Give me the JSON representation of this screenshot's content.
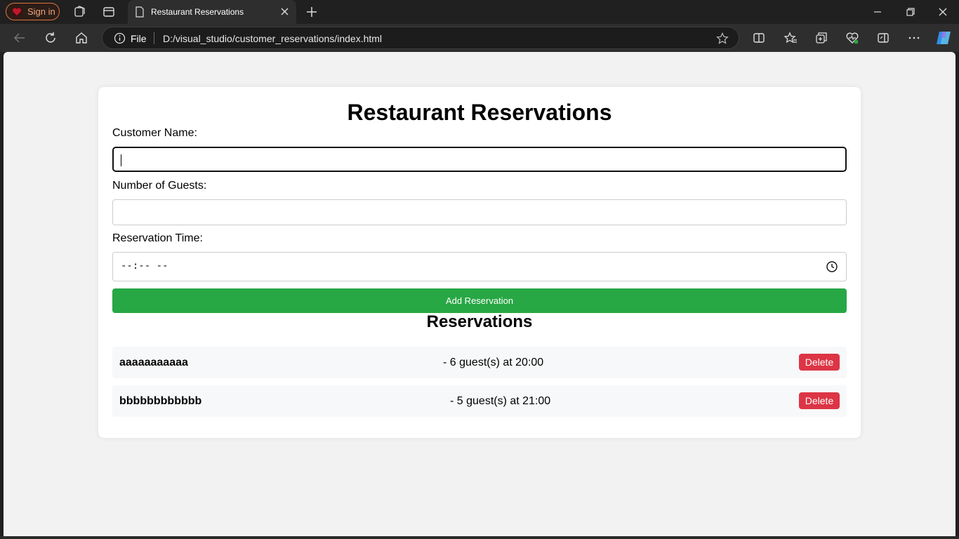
{
  "browser": {
    "profile_button": "Sign in",
    "tab_title": "Restaurant Reservations",
    "address_scheme": "File",
    "address_url": "D:/visual_studio/customer_reservations/index.html",
    "accent_color": "#e0733a"
  },
  "page": {
    "heading": "Restaurant Reservations",
    "fields": {
      "name_label": "Customer Name:",
      "name_value": "",
      "guests_label": "Number of Guests:",
      "guests_value": "",
      "time_label": "Reservation Time:",
      "time_placeholder": "--:-- --"
    },
    "add_button": "Add Reservation",
    "add_button_color": "#28a745",
    "list_heading": "Reservations",
    "reservations": [
      {
        "name": "aaaaaaaaaaa",
        "detail": "- 6 guest(s) at 20:00",
        "delete_label": "Delete"
      },
      {
        "name": "bbbbbbbbbbbb",
        "detail": "- 5 guest(s) at 21:00",
        "delete_label": "Delete"
      }
    ],
    "delete_color": "#dc3545"
  },
  "icons": [
    "profile-heart-icon",
    "workspaces-icon",
    "tab-actions-icon",
    "page-icon",
    "close-tab-icon",
    "new-tab-icon",
    "minimize-icon",
    "restore-icon",
    "close-window-icon",
    "back-icon",
    "refresh-icon",
    "home-icon",
    "info-icon",
    "favorite-star-icon",
    "split-screen-icon",
    "favorites-icon",
    "collections-icon",
    "browser-essentials-icon",
    "sidebar-icon",
    "more-icon",
    "copilot-icon",
    "clock-icon"
  ]
}
